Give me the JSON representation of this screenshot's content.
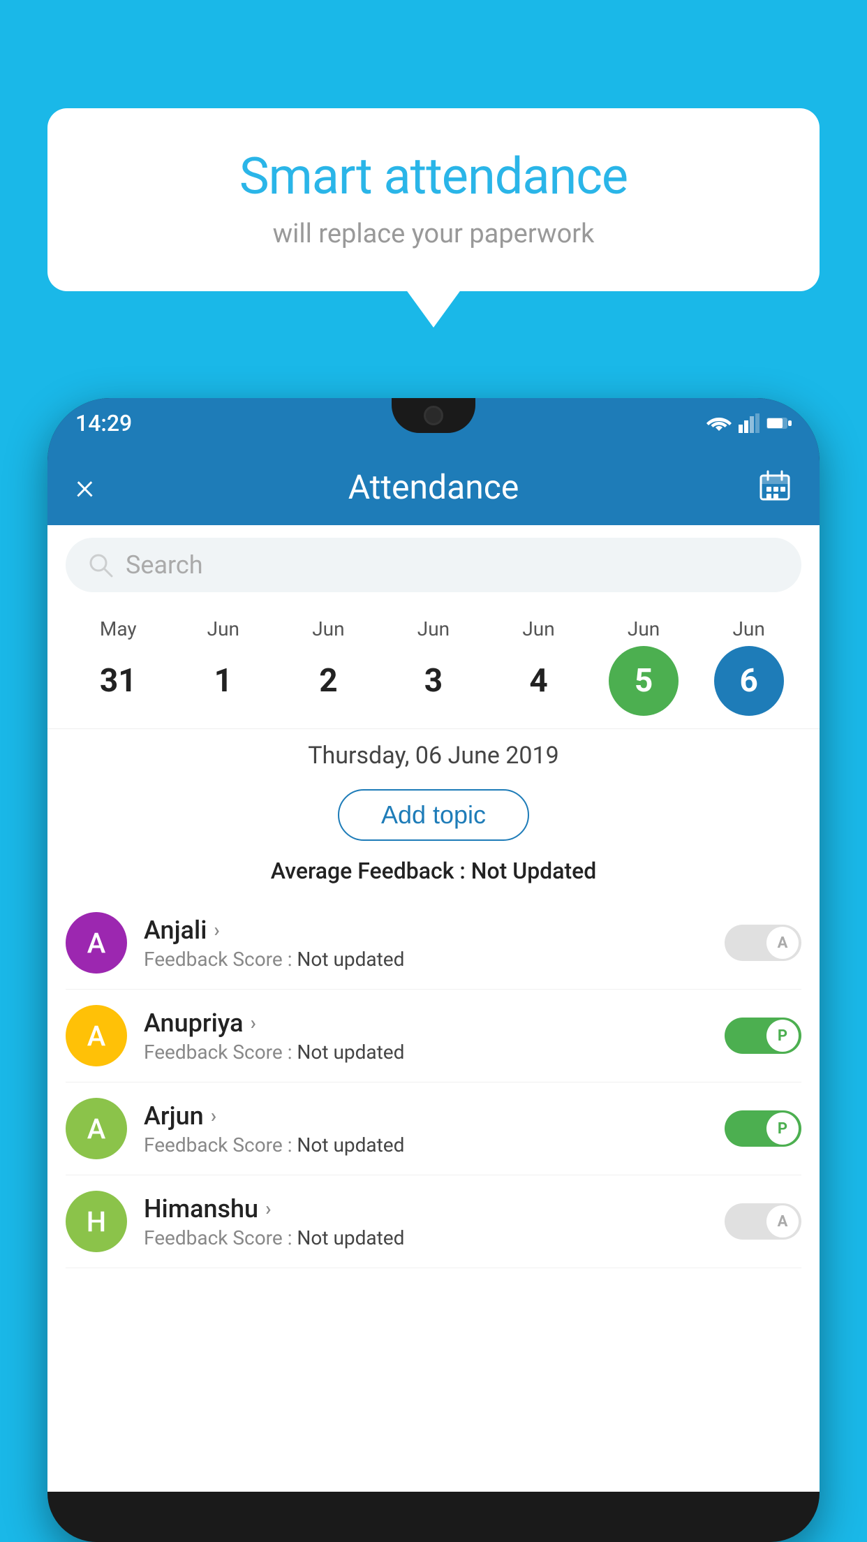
{
  "background_color": "#1ab8e8",
  "bubble": {
    "title": "Smart attendance",
    "subtitle": "will replace your paperwork"
  },
  "status_bar": {
    "time": "14:29"
  },
  "app_bar": {
    "title": "Attendance",
    "close_label": "×"
  },
  "search": {
    "placeholder": "Search"
  },
  "calendar": {
    "months": [
      "May",
      "Jun",
      "Jun",
      "Jun",
      "Jun",
      "Jun",
      "Jun"
    ],
    "dates": [
      "31",
      "1",
      "2",
      "3",
      "4",
      "5",
      "6"
    ],
    "today_index": 5,
    "selected_index": 6
  },
  "selected_date_label": "Thursday, 06 June 2019",
  "add_topic_label": "Add topic",
  "avg_feedback_label": "Average Feedback : ",
  "avg_feedback_value": "Not Updated",
  "students": [
    {
      "name": "Anjali",
      "avatar_letter": "A",
      "avatar_color": "#9c27b0",
      "feedback_label": "Feedback Score : ",
      "feedback_value": "Not updated",
      "toggle_state": "off",
      "toggle_label": "A"
    },
    {
      "name": "Anupriya",
      "avatar_letter": "A",
      "avatar_color": "#ffc107",
      "feedback_label": "Feedback Score : ",
      "feedback_value": "Not updated",
      "toggle_state": "on",
      "toggle_label": "P"
    },
    {
      "name": "Arjun",
      "avatar_letter": "A",
      "avatar_color": "#8bc34a",
      "feedback_label": "Feedback Score : ",
      "feedback_value": "Not updated",
      "toggle_state": "on",
      "toggle_label": "P"
    },
    {
      "name": "Himanshu",
      "avatar_letter": "H",
      "avatar_color": "#8bc34a",
      "feedback_label": "Feedback Score : ",
      "feedback_value": "Not updated",
      "toggle_state": "off",
      "toggle_label": "A"
    }
  ]
}
